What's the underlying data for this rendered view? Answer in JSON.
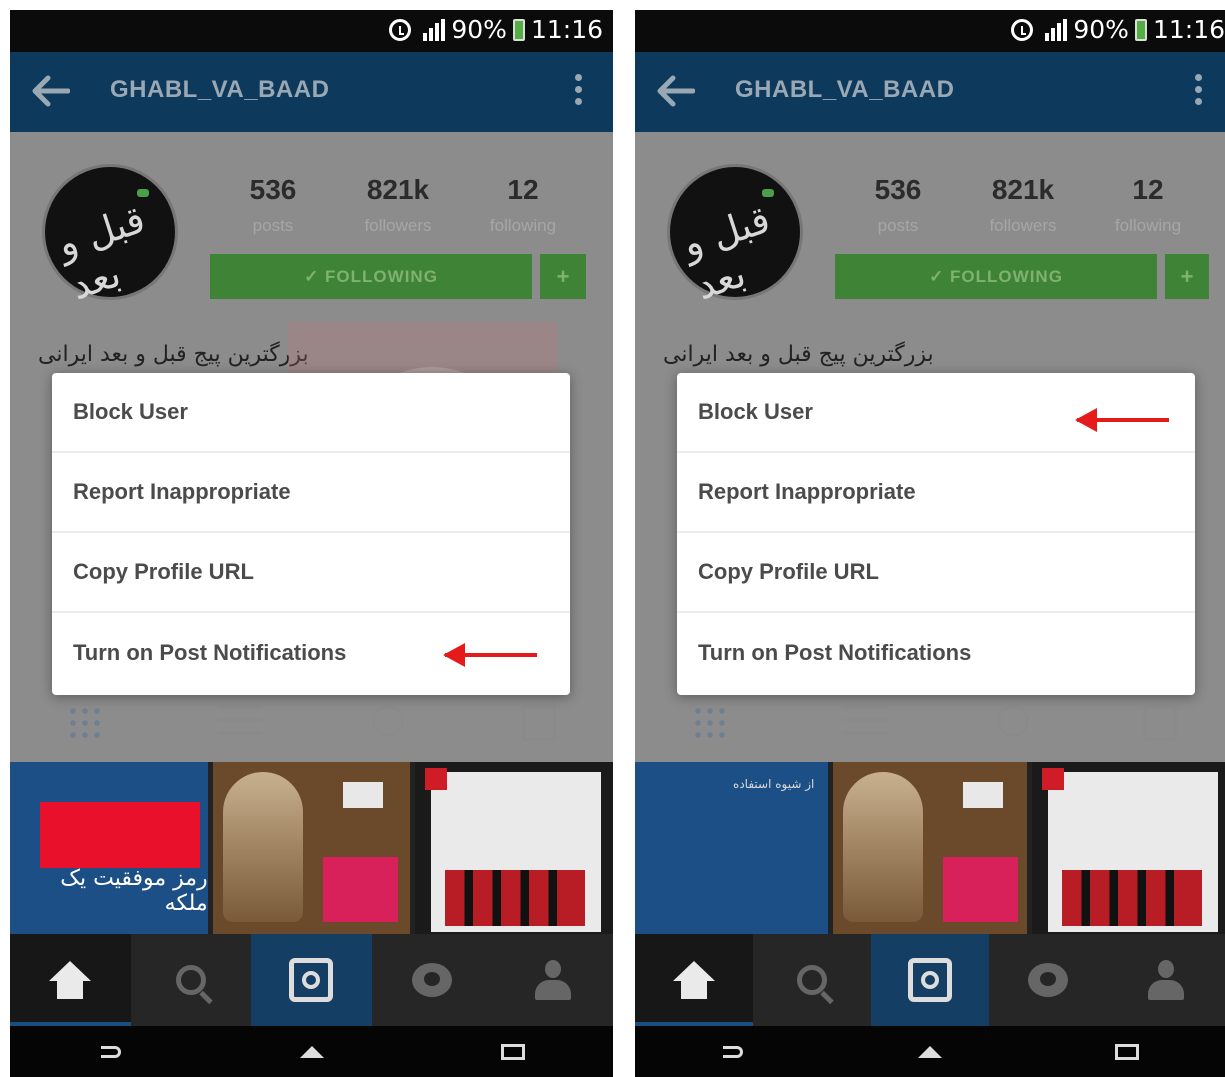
{
  "screens": [
    {
      "status": {
        "battery": "90%",
        "time": "11:16"
      },
      "header": {
        "title": "GHABL_VA_BAAD"
      },
      "profile": {
        "avatar_text": "قبل و بعد",
        "stats": [
          {
            "value": "536",
            "label": "posts"
          },
          {
            "value": "821k",
            "label": "followers"
          },
          {
            "value": "12",
            "label": "following"
          }
        ],
        "follow_label": "✓ FOLLOWING",
        "plus_label": "+",
        "bio": "بزرگترین پیج قبل و بعد ایرانی"
      },
      "menu": {
        "items": [
          "Block User",
          "Report Inappropriate",
          "Copy Profile URL",
          "Turn on Post Notifications"
        ]
      },
      "highlighted_item": "Turn on Post Notifications",
      "thumbnail_text": "رمز موفقیت یک ملکه"
    },
    {
      "status": {
        "battery": "90%",
        "time": "11:16"
      },
      "header": {
        "title": "GHABL_VA_BAAD"
      },
      "profile": {
        "avatar_text": "قبل و بعد",
        "stats": [
          {
            "value": "536",
            "label": "posts"
          },
          {
            "value": "821k",
            "label": "followers"
          },
          {
            "value": "12",
            "label": "following"
          }
        ],
        "follow_label": "✓ FOLLOWING",
        "plus_label": "+",
        "bio": "بزرگترین پیج قبل و بعد ایرانی"
      },
      "menu": {
        "items": [
          "Block User",
          "Report Inappropriate",
          "Copy Profile URL",
          "Turn on Post Notifications"
        ]
      },
      "highlighted_item": "Block User",
      "thumbnail_text": "از شیوه استفاده"
    }
  ],
  "colors": {
    "accent_red": "#e51b1b",
    "topbar": "#0d3a5c",
    "follow_green": "#3f8436"
  },
  "icons": [
    "alarm-icon",
    "signal-icon",
    "battery-icon",
    "back-arrow-icon",
    "overflow-menu-icon",
    "grid-view-icon",
    "list-view-icon",
    "location-icon",
    "tagged-icon",
    "home-icon",
    "search-icon",
    "camera-icon",
    "activity-icon",
    "profile-icon",
    "nav-back-icon",
    "nav-home-icon",
    "nav-recent-icon"
  ]
}
